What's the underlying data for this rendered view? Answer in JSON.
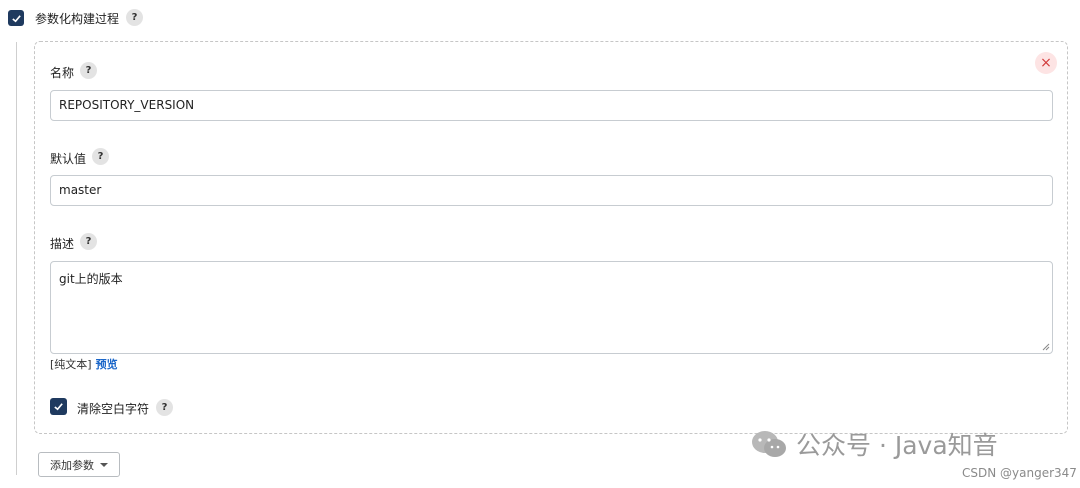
{
  "section": {
    "title": "参数化构建过程",
    "checked": true
  },
  "fields": {
    "name": {
      "label": "名称",
      "value": "REPOSITORY_VERSION"
    },
    "default": {
      "label": "默认值",
      "value": "master"
    },
    "description": {
      "label": "描述",
      "value": "git上的版本"
    }
  },
  "format": {
    "plain_text": "[纯文本]",
    "preview": "预览"
  },
  "trim": {
    "label": "清除空白字符",
    "checked": true
  },
  "help": {
    "symbol": "?"
  },
  "close": {
    "symbol": "×"
  },
  "add_param": {
    "label": "添加参数"
  },
  "watermark": {
    "text": "公众号 · Java知音",
    "icon": "wechat-icon"
  },
  "credit": {
    "text": "CSDN @yanger347"
  },
  "colors": {
    "accent": "#1f3a5f",
    "link": "#1a66c9",
    "close_bg": "#fde4e4",
    "close_fg": "#d23b3b"
  }
}
